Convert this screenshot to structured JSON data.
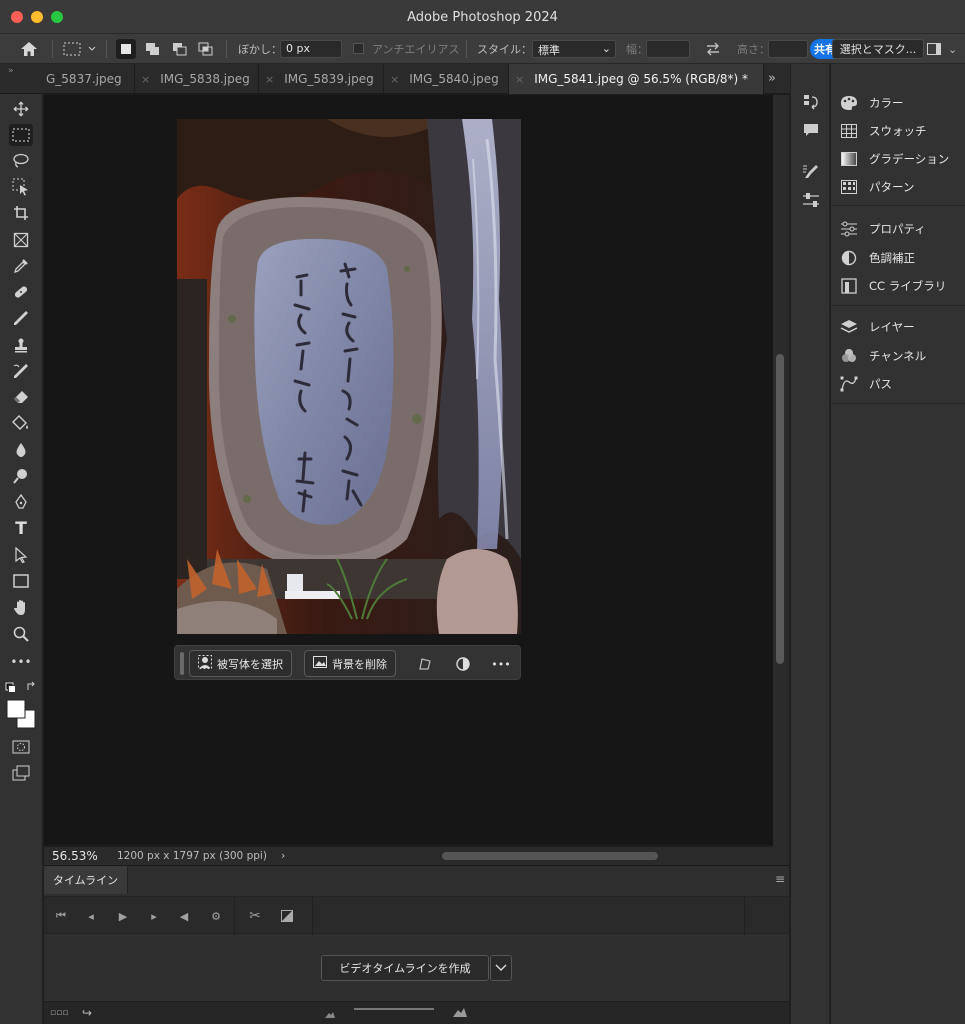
{
  "window": {
    "title": "Adobe Photoshop 2024"
  },
  "options_bar": {
    "feather_label": "ぼかし：",
    "feather_value": "0 px",
    "antialias_label": "アンチエイリアス",
    "style_label": "スタイル：",
    "style_value": "標準",
    "width_label": "幅：",
    "height_label": "高さ：",
    "share_label": "共有",
    "select_mask_label": "選択とマスク..."
  },
  "tabs": [
    {
      "label": "G_5837.jpeg",
      "active": false
    },
    {
      "label": "IMG_5838.jpeg",
      "active": false
    },
    {
      "label": "IMG_5839.jpeg",
      "active": false
    },
    {
      "label": "IMG_5840.jpeg",
      "active": false
    },
    {
      "label": "IMG_5841.jpeg @ 56.5% (RGB/8*) *",
      "active": true
    }
  ],
  "tab_close": "×",
  "tools": [
    "move-icon",
    "marquee-icon",
    "lasso-icon",
    "object-select-icon",
    "crop-icon",
    "frame-icon",
    "eyedropper-icon",
    "healing-brush-icon",
    "brush-icon",
    "stamp-icon",
    "history-brush-icon",
    "eraser-icon",
    "paint-bucket-icon",
    "blur-icon",
    "dodge-icon",
    "pen-icon",
    "type-icon",
    "path-select-icon",
    "rectangle-icon",
    "hand-icon",
    "zoom-icon",
    "more-tools-icon"
  ],
  "contextual_bar": {
    "select_subject": "被写体を選択",
    "remove_bg": "背景を削除",
    "more": "•••"
  },
  "status": {
    "zoom": "56.53%",
    "doc_size": "1200 px x 1797 px (300 ppi)",
    "arrow": "›"
  },
  "timeline": {
    "tab_label": "タイムライン",
    "create_button": "ビデオタイムラインを作成"
  },
  "panels": {
    "group1": [
      "カラー",
      "スウォッチ",
      "グラデーション",
      "パターン"
    ],
    "group2": [
      "プロパティ",
      "色調補正",
      "CC ライブラリ"
    ],
    "group3": [
      "レイヤー",
      "チャンネル",
      "パス"
    ]
  },
  "colors": {
    "accent": "#1473e6",
    "background": "#1e1e1e",
    "panel": "#323232",
    "canvas": "#161616"
  }
}
